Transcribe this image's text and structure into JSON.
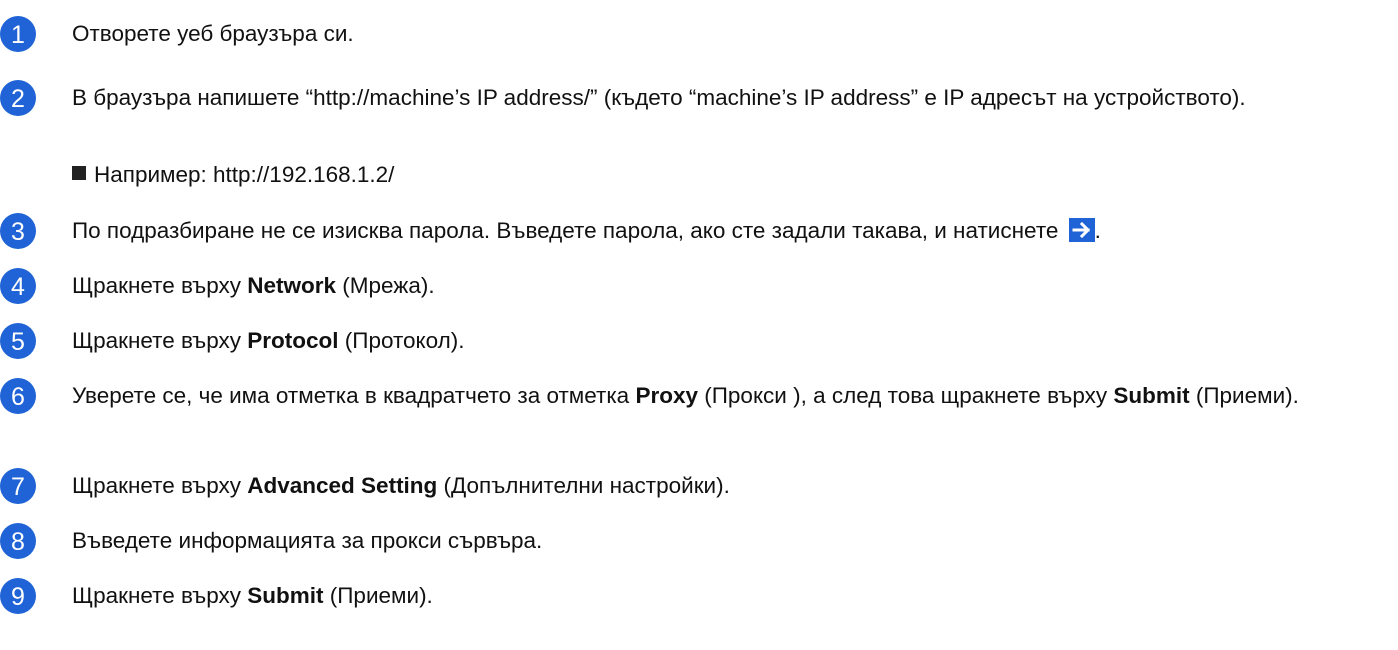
{
  "accent_color": "#1f63d6",
  "steps": [
    {
      "number": "1",
      "text": "Отворете уеб браузъра си."
    },
    {
      "number": "2",
      "text": "В браузъра напишете “http://machine’s IP address/” (където “machine’s IP address” е IP адресът на устройството).",
      "example": "Например: http://192.168.1.2/"
    },
    {
      "number": "3",
      "text": "По подразбиране не се изисква парола. Въведете парола, ако сте задали такава, и натиснете",
      "end": ".",
      "icon": "arrow-right-icon"
    },
    {
      "number": "4",
      "prefix": "Щракнете върху ",
      "bold": "Network",
      "suffix": " (Мрежа)."
    },
    {
      "number": "5",
      "prefix": "Щракнете върху ",
      "bold": "Protocol",
      "suffix": " (Протокол)."
    },
    {
      "number": "6",
      "prefix": "Уверете се, че има отметка в квадратчето за отметка ",
      "bold": "Proxy",
      "middle": " (Прокси ), а след това щракнете върху ",
      "bold2": "Submit",
      "suffix": " (Приеми)."
    },
    {
      "number": "7",
      "prefix": "Щракнете върху ",
      "bold": "Advanced Setting",
      "suffix": " (Допълнителни настройки)."
    },
    {
      "number": "8",
      "text": "Въведете информацията за прокси сървъра."
    },
    {
      "number": "9",
      "prefix": "Щракнете върху ",
      "bold": "Submit",
      "suffix": " (Приеми)."
    }
  ]
}
